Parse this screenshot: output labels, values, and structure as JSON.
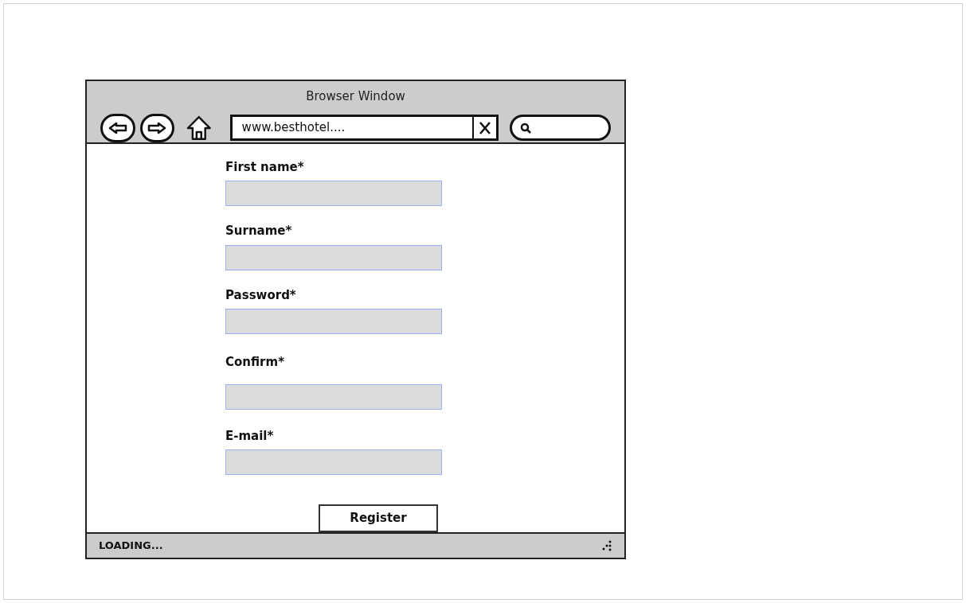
{
  "window": {
    "title": "Browser Window"
  },
  "toolbar": {
    "address": "www.besthotel...."
  },
  "form": {
    "fields": [
      {
        "label": "First name*"
      },
      {
        "label": "Surname*"
      },
      {
        "label": "Password*"
      },
      {
        "label": "Confirm*"
      },
      {
        "label": "E-mail*"
      }
    ],
    "submit": "Register"
  },
  "status_bar": {
    "text": "LOADING..."
  }
}
